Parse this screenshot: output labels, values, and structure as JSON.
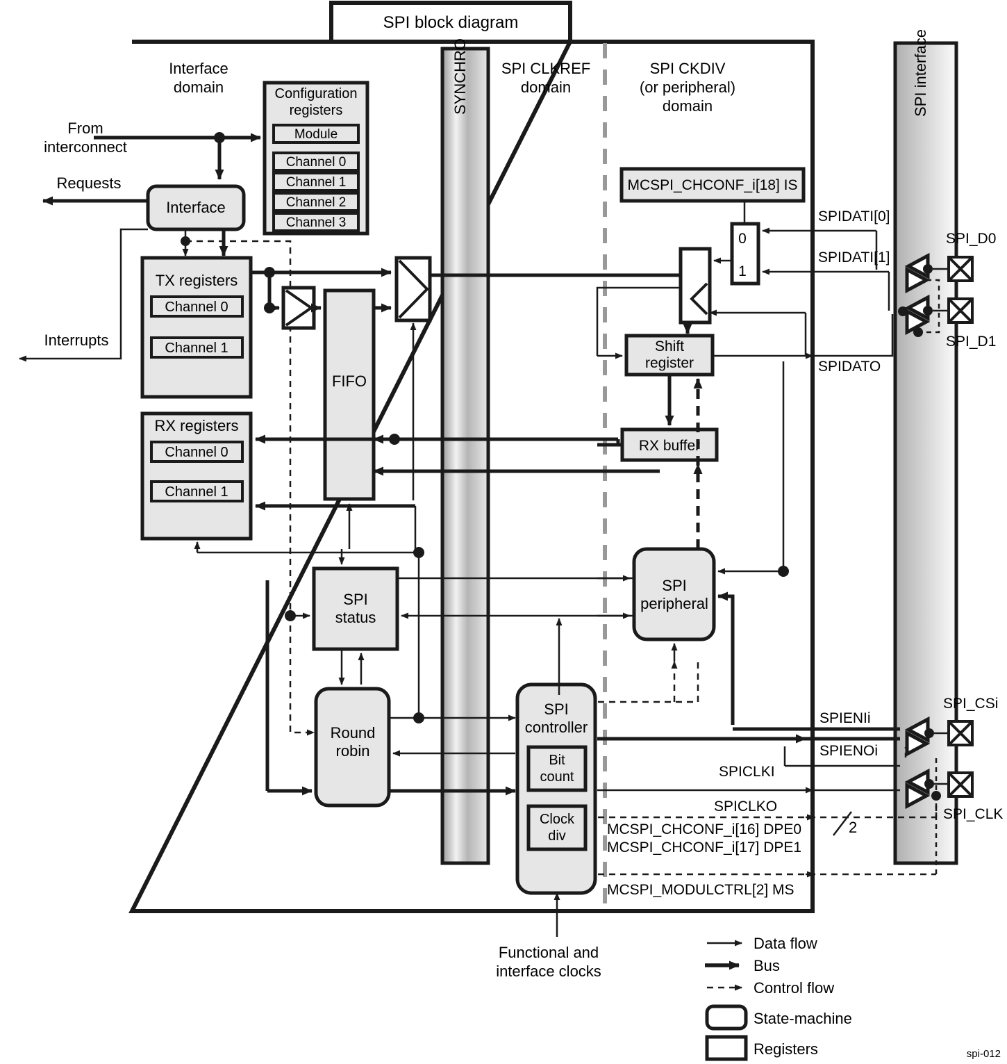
{
  "figure": {
    "title": "SPI block diagram",
    "caption_id": "spi-012"
  },
  "domains": [
    {
      "id": "interface-domain",
      "label": "Interface\ndomain",
      "line1": "Interface",
      "line2": "domain"
    },
    {
      "id": "clkref-domain",
      "label": "SPI CLKREF domain",
      "line1": "SPI CLKREF",
      "line2": "domain"
    },
    {
      "id": "ckdiv-domain",
      "label": "SPI CKDIV (or peripheral) domain",
      "line1": "SPI CKDIV",
      "line2": "(or peripheral)",
      "line3": "domain"
    }
  ],
  "columns": {
    "synchro": "SYNCHRO",
    "spi_interface": "SPI interface"
  },
  "external_labels": {
    "from_interconnect_l1": "From",
    "from_interconnect_l2": "interconnect",
    "requests": "Requests",
    "interrupts": "Interrupts",
    "clocks_l1": "Functional and",
    "clocks_l2": "interface clocks"
  },
  "blocks": {
    "interface": "Interface",
    "config_registers": {
      "title_l1": "Configuration",
      "title_l2": "registers",
      "items": [
        "Module",
        "Channel 0",
        "Channel 1",
        "Channel 2",
        "Channel 3"
      ]
    },
    "tx_registers": {
      "title": "TX registers",
      "items": [
        "Channel 0",
        "Channel 1"
      ]
    },
    "rx_registers": {
      "title": "RX registers",
      "items": [
        "Channel 0",
        "Channel 1"
      ]
    },
    "fifo": "FIFO",
    "spi_status_l1": "SPI",
    "spi_status_l2": "status",
    "round_robin_l1": "Round",
    "round_robin_l2": "robin",
    "spi_controller_l1": "SPI",
    "spi_controller_l2": "controller",
    "bit_count_l1": "Bit",
    "bit_count_l2": "count",
    "clock_div_l1": "Clock",
    "clock_div_l2": "div",
    "shift_register_l1": "Shift",
    "shift_register_l2": "register",
    "rx_buffer": "RX buffer",
    "spi_peripheral_l1": "SPI",
    "spi_peripheral_l2": "peripheral",
    "chconf_is": "MCSPI_CHCONF_i[18] IS",
    "mux_sel_0": "0",
    "mux_sel_1": "1"
  },
  "signals": {
    "spidati0": "SPIDATI[0]",
    "spidati1": "SPIDATI[1]",
    "spidato": "SPIDATO",
    "spienii": "SPIENIi",
    "spienoi": "SPIENOi",
    "spiclki": "SPICLKI",
    "spiclko": "SPICLKO",
    "bus_width": "2"
  },
  "pins": {
    "spi_d0": "SPI_D0",
    "spi_d1": "SPI_D1",
    "spi_csi": "SPI_CSi",
    "spi_clk": "SPI_CLK"
  },
  "control_registers": [
    "MCSPI_CHCONF_i[16] DPE0",
    "MCSPI_CHCONF_i[17] DPE1",
    "MCSPI_MODULCTRL[2] MS"
  ],
  "legend": [
    {
      "kind": "thin-arrow",
      "label": "Data flow"
    },
    {
      "kind": "thick-arrow",
      "label": "Bus"
    },
    {
      "kind": "dashed-arrow",
      "label": "Control flow"
    },
    {
      "kind": "rounded-box",
      "label": "State-machine"
    },
    {
      "kind": "square-box",
      "label": "Registers"
    }
  ],
  "colors": {
    "stroke": "#1a1a1a",
    "block_fill": "#e6e6e6",
    "domain_divider": "#999999",
    "page_bg": "#ffffff"
  }
}
